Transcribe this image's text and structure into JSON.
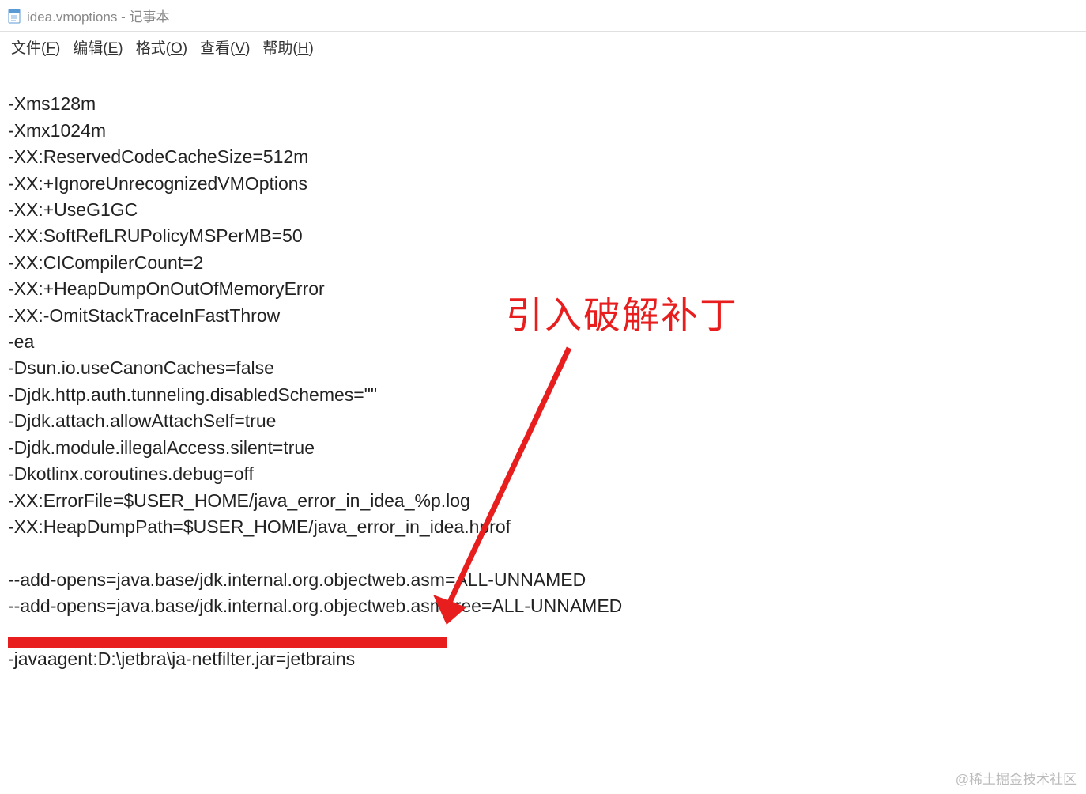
{
  "window": {
    "title": "idea.vmoptions - 记事本"
  },
  "menu": {
    "file": "文件(F)",
    "edit": "编辑(E)",
    "format": "格式(O)",
    "view": "查看(V)",
    "help": "帮助(H)"
  },
  "content": {
    "lines": [
      "-Xms128m",
      "-Xmx1024m",
      "-XX:ReservedCodeCacheSize=512m",
      "-XX:+IgnoreUnrecognizedVMOptions",
      "-XX:+UseG1GC",
      "-XX:SoftRefLRUPolicyMSPerMB=50",
      "-XX:CICompilerCount=2",
      "-XX:+HeapDumpOnOutOfMemoryError",
      "-XX:-OmitStackTraceInFastThrow",
      "-ea",
      "-Dsun.io.useCanonCaches=false",
      "-Djdk.http.auth.tunneling.disabledSchemes=\"\"",
      "-Djdk.attach.allowAttachSelf=true",
      "-Djdk.module.illegalAccess.silent=true",
      "-Dkotlinx.coroutines.debug=off",
      "-XX:ErrorFile=$USER_HOME/java_error_in_idea_%p.log",
      "-XX:HeapDumpPath=$USER_HOME/java_error_in_idea.hprof",
      "",
      "--add-opens=java.base/jdk.internal.org.objectweb.asm=ALL-UNNAMED",
      "--add-opens=java.base/jdk.internal.org.objectweb.asm.tree=ALL-UNNAMED",
      "",
      "-javaagent:D:\\jetbra\\ja-netfilter.jar=jetbrains"
    ]
  },
  "annotation": {
    "text": "引入破解补丁",
    "color": "#e81e1e"
  },
  "watermark": "@稀土掘金技术社区"
}
